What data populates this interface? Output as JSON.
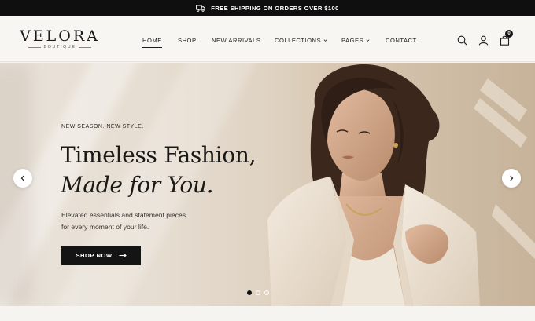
{
  "announcement": {
    "text": "FREE SHIPPING ON ORDERS OVER $100",
    "icon": "truck-icon"
  },
  "brand": {
    "name": "VELORA",
    "tagline": "BOUTIQUE"
  },
  "nav": {
    "items": [
      {
        "label": "HOME",
        "active": true,
        "dropdown": false
      },
      {
        "label": "SHOP",
        "active": false,
        "dropdown": false
      },
      {
        "label": "NEW ARRIVALS",
        "active": false,
        "dropdown": false
      },
      {
        "label": "COLLECTIONS",
        "active": false,
        "dropdown": true
      },
      {
        "label": "PAGES",
        "active": false,
        "dropdown": true
      },
      {
        "label": "CONTACT",
        "active": false,
        "dropdown": false
      }
    ]
  },
  "header_icons": {
    "search": "search-icon",
    "account": "user-icon",
    "cart": "shopping-bag-icon",
    "cart_count": "0"
  },
  "hero": {
    "eyebrow": "NEW SEASON. NEW STYLE.",
    "title_line1": "Timeless Fashion,",
    "title_line2": "Made for You.",
    "description_line1": "Elevated essentials and statement pieces",
    "description_line2": "for every moment of your life.",
    "cta_label": "SHOP NOW",
    "slides_total": 3,
    "active_slide": 1
  },
  "colors": {
    "topbar": "#0f0f0f",
    "accent": "#141414",
    "background": "#f7f6f3"
  }
}
